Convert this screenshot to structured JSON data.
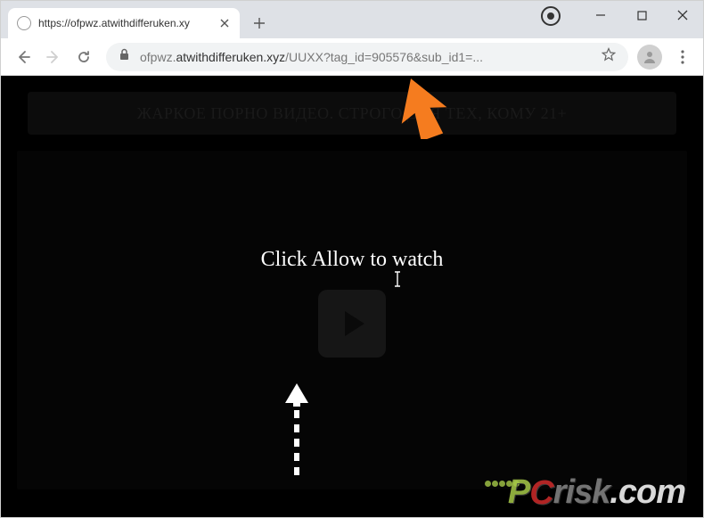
{
  "tab": {
    "title": "https://ofpwz.atwithdifferuken.xy"
  },
  "url": {
    "host_prefix": "ofpwz.",
    "host_dark": "atwithdifferuken.xyz",
    "path": "/UUXX?tag_id=905576&sub_id1=..."
  },
  "page": {
    "banner": "ЖАРКОЕ ПОРНО ВИДЕО. СТРОГО ДЛЯ ТЕХ, КОМУ 21+",
    "prompt": "Click Allow to watch"
  },
  "watermark": {
    "p": "P",
    "c": "C",
    "rest": "risk",
    "dot": ".com"
  }
}
